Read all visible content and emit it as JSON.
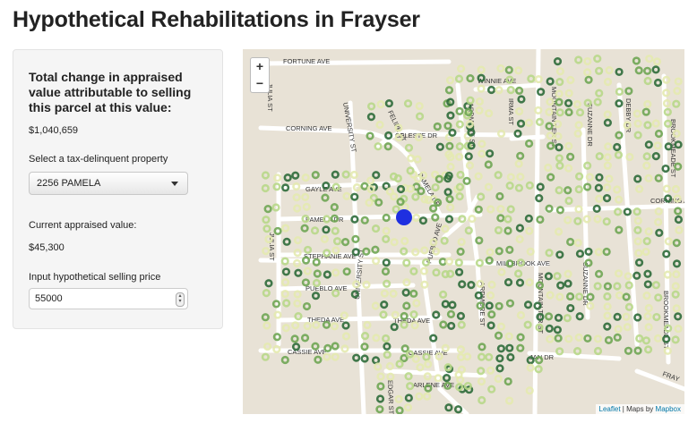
{
  "page": {
    "title": "Hypothetical Rehabilitations in Frayser"
  },
  "sidebar": {
    "total_heading": "Total change in appraised value attributable to selling this parcel at this value:",
    "total_value": "$1,040,659",
    "select_label": "Select a tax-delinquent property",
    "select_value": "2256 PAMELA",
    "current_label": "Current appraised value:",
    "current_value": "$45,300",
    "price_label": "Input hypothetical selling price",
    "price_value": "55000"
  },
  "map": {
    "zoom_in": "+",
    "zoom_out": "−",
    "attribution_leaflet": "Leaflet",
    "attribution_sep": " | Maps by ",
    "attribution_mapbox": "Mapbox",
    "colors": {
      "land": "#e8e2d6",
      "road": "#ffffff",
      "selected": "#1f2fe0",
      "dark_green": "#2e6b3a",
      "mid_green": "#6fa654",
      "light_green": "#b8d88a",
      "pale_yellow": "#e4eab0"
    },
    "streets": [
      "FORTUNE AVE",
      "JULIA ST",
      "UNIVERSITY ST",
      "CORNING AVE",
      "CELESTE DR",
      "FELIPE ST",
      "WINNIE AVE",
      "IRMA ST",
      "ARDMORE ST",
      "MOUNTAIN TER ST",
      "SUZANNE DR",
      "DEBBY DR",
      "BROOKMEADE ST",
      "GAYLE AVE",
      "PAMELA DR",
      "CORNING AVE",
      "PAMELA DR",
      "JULIA ST",
      "STEPHANIE AVE",
      "PUEBLO AVE",
      "PUEBLO AVE",
      "MILLBROOK AVE",
      "SUZANNE DR",
      "MOUNTAIN TER ST",
      "ARDMORE ST",
      "THEDA AVE",
      "THEDA AVE",
      "UNIVERSITY ST",
      "BROOKMEADE ST",
      "CASSIE AVE",
      "CASSIE AVE",
      "JAN DR",
      "ARLENE AVE",
      "EDGAR ST",
      "FRAY"
    ]
  }
}
